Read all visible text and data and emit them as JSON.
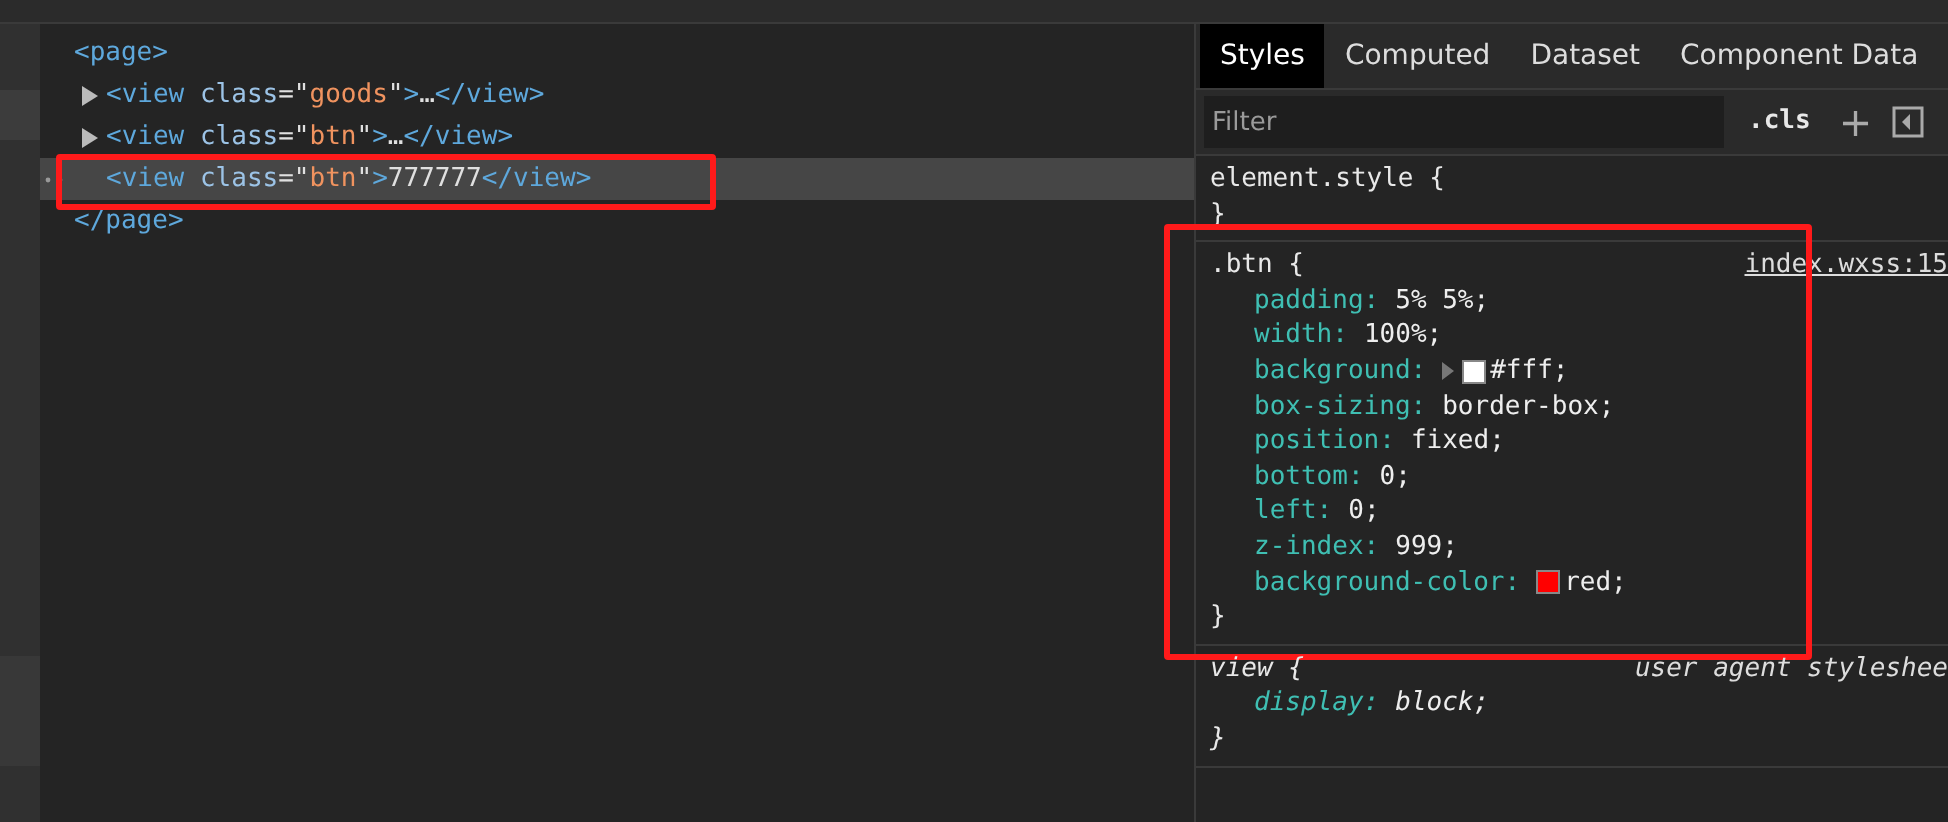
{
  "elements_tree": {
    "open": [
      {
        "kind": "tag",
        "text": "<page>"
      }
    ],
    "close": [
      {
        "kind": "tag",
        "text": "</page>"
      }
    ],
    "children": [
      {
        "expanded": false,
        "selected": false,
        "highlighted": false,
        "tokens": [
          {
            "kind": "tag",
            "text": "<view"
          },
          {
            "kind": "attr",
            "text": " class"
          },
          {
            "kind": "text",
            "text": "=\""
          },
          {
            "kind": "value",
            "text": "goods"
          },
          {
            "kind": "text",
            "text": "\""
          },
          {
            "kind": "tag",
            "text": ">"
          },
          {
            "kind": "text",
            "text": "…"
          },
          {
            "kind": "tag",
            "text": "</view>"
          }
        ]
      },
      {
        "expanded": false,
        "selected": false,
        "highlighted": false,
        "tokens": [
          {
            "kind": "tag",
            "text": "<view"
          },
          {
            "kind": "attr",
            "text": " class"
          },
          {
            "kind": "text",
            "text": "=\""
          },
          {
            "kind": "value",
            "text": "btn"
          },
          {
            "kind": "text",
            "text": "\""
          },
          {
            "kind": "tag",
            "text": ">"
          },
          {
            "kind": "text",
            "text": "…"
          },
          {
            "kind": "tag",
            "text": "</view>"
          }
        ]
      },
      {
        "selected": true,
        "highlighted": true,
        "tokens": [
          {
            "kind": "tag",
            "text": "<view"
          },
          {
            "kind": "attr",
            "text": " class"
          },
          {
            "kind": "text",
            "text": "=\""
          },
          {
            "kind": "value",
            "text": "btn"
          },
          {
            "kind": "text",
            "text": "\""
          },
          {
            "kind": "tag",
            "text": ">"
          },
          {
            "kind": "text",
            "text": "777777"
          },
          {
            "kind": "tag",
            "text": "</view>"
          }
        ]
      }
    ]
  },
  "styles_panel": {
    "tabs": [
      {
        "label": "Styles",
        "selected": true
      },
      {
        "label": "Computed",
        "selected": false
      },
      {
        "label": "Dataset",
        "selected": false
      },
      {
        "label": "Component Data",
        "selected": false
      }
    ],
    "filter": {
      "placeholder": "Filter"
    },
    "cls_button": ".cls",
    "add_button": "+",
    "rules": [
      {
        "kind": "inline",
        "selector": "element.style {",
        "close": "}",
        "highlighted": false
      },
      {
        "kind": "author",
        "selector": ".btn {",
        "source": "index.wxss:15",
        "close": "}",
        "highlighted": true,
        "declarations": [
          {
            "property": "padding:",
            "value": "5% 5%;"
          },
          {
            "property": "width:",
            "value": "100%;"
          },
          {
            "property": "background:",
            "value": "#fff;",
            "expandable": true,
            "color": "#ffffff"
          },
          {
            "property": "box-sizing:",
            "value": "border-box;"
          },
          {
            "property": "position:",
            "value": "fixed;"
          },
          {
            "property": "bottom:",
            "value": "0;"
          },
          {
            "property": "left:",
            "value": "0;"
          },
          {
            "property": "z-index:",
            "value": "999;"
          },
          {
            "property": "background-color:",
            "value": "red;",
            "color": "#ff0000"
          }
        ]
      },
      {
        "kind": "user_agent",
        "selector": "view {",
        "source": "user agent styleshee",
        "close": "}",
        "highlighted": false,
        "declarations": [
          {
            "property": "display:",
            "value": "block;"
          }
        ]
      }
    ]
  }
}
